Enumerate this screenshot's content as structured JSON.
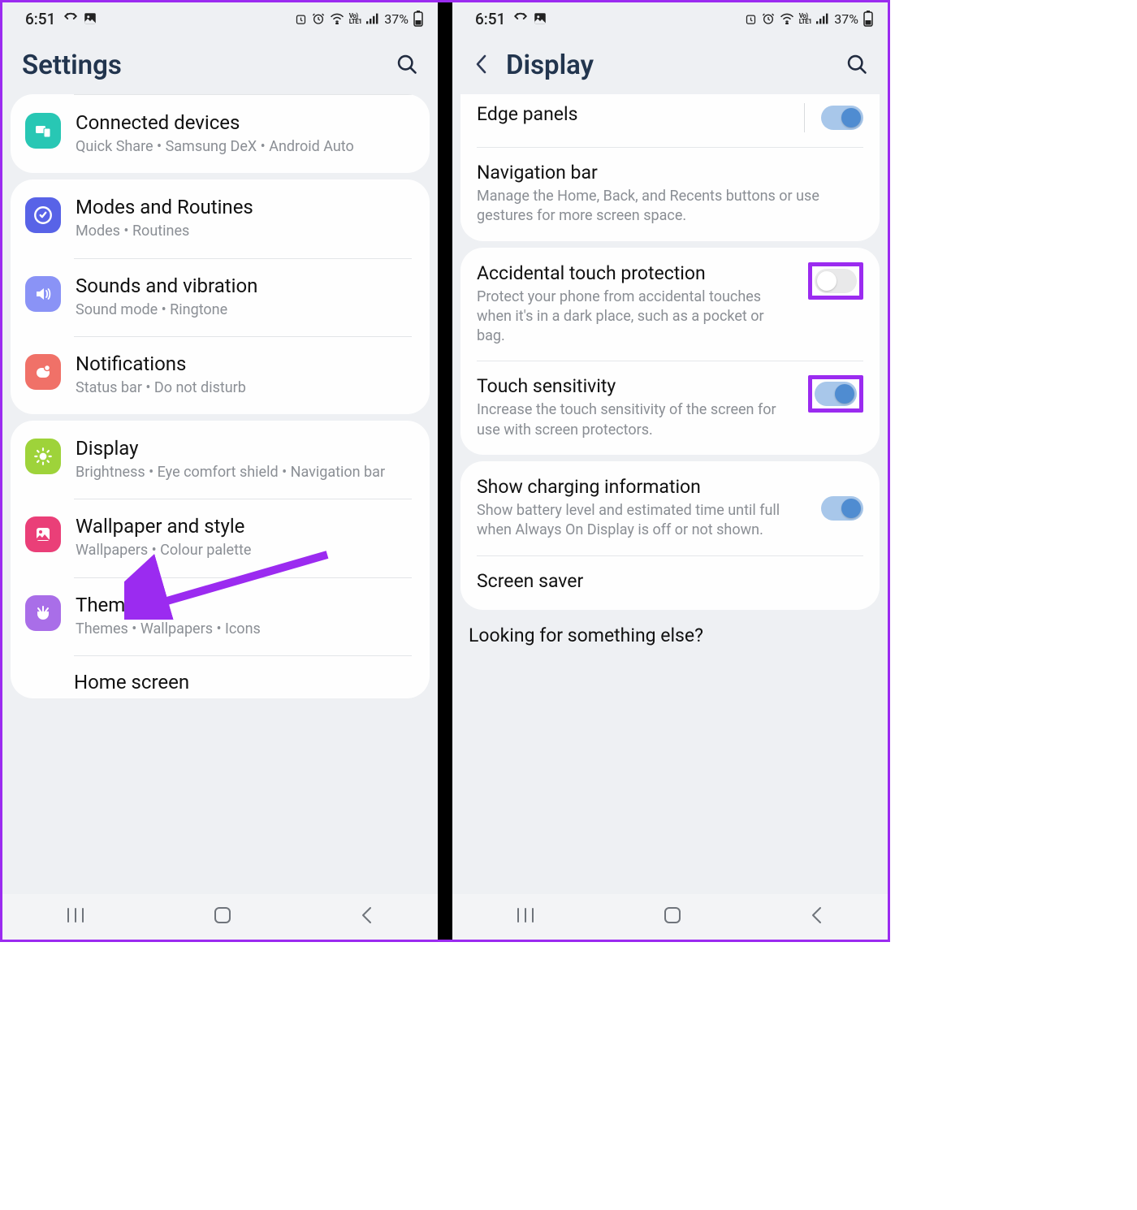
{
  "status": {
    "time": "6:51",
    "battery": "37%"
  },
  "left": {
    "title": "Settings",
    "groups": [
      {
        "items": [
          {
            "icon": "connected",
            "color": "#28c7b4",
            "title": "Connected devices",
            "sub": "Quick Share  •  Samsung DeX  •  Android Auto"
          }
        ]
      },
      {
        "items": [
          {
            "icon": "modes",
            "color": "#5863e7",
            "title": "Modes and Routines",
            "sub": "Modes  •  Routines"
          },
          {
            "icon": "sound",
            "color": "#8a93f6",
            "title": "Sounds and vibration",
            "sub": "Sound mode  •  Ringtone"
          },
          {
            "icon": "notif",
            "color": "#f07168",
            "title": "Notifications",
            "sub": "Status bar  •  Do not disturb"
          }
        ]
      },
      {
        "items": [
          {
            "icon": "display",
            "color": "#9ed33a",
            "title": "Display",
            "sub": "Brightness  •  Eye comfort shield  •  Navigation bar"
          },
          {
            "icon": "wallpaper",
            "color": "#ea3f78",
            "title": "Wallpaper and style",
            "sub": "Wallpapers  •  Colour palette"
          },
          {
            "icon": "themes",
            "color": "#a96ee8",
            "title": "Themes",
            "sub": "Themes  •  Wallpapers  •  Icons"
          }
        ]
      }
    ],
    "peek": "Home screen"
  },
  "right": {
    "title": "Display",
    "group1": [
      {
        "title": "Edge panels",
        "toggle": true,
        "separator": true
      },
      {
        "title": "Navigation bar",
        "sub": "Manage the Home, Back, and Recents buttons or use gestures for more screen space."
      }
    ],
    "group2": [
      {
        "title": "Accidental touch protection",
        "sub": "Protect your phone from accidental touches when it's in a dark place, such as a pocket or bag.",
        "toggle": false,
        "highlight": true
      },
      {
        "title": "Touch sensitivity",
        "sub": "Increase the touch sensitivity of the screen for use with screen protectors.",
        "toggle": true,
        "highlight": true
      }
    ],
    "group3": [
      {
        "title": "Show charging information",
        "sub": "Show battery level and estimated time until full when Always On Display is off or not shown.",
        "toggle": true
      },
      {
        "title": "Screen saver"
      }
    ],
    "peek": "Looking for something else?"
  }
}
